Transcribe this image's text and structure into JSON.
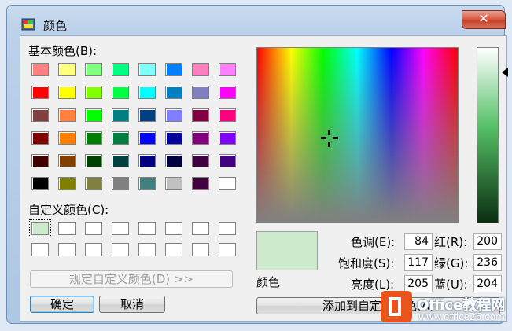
{
  "window": {
    "title": "颜色",
    "close_label": "✕"
  },
  "basic_colors": {
    "label": "基本颜色(B):",
    "swatches": [
      "#ff8080",
      "#ffff80",
      "#80ff80",
      "#00ff80",
      "#80ffff",
      "#0080ff",
      "#ff80c0",
      "#ff80ff",
      "#ff0000",
      "#ffff00",
      "#80ff00",
      "#00ff40",
      "#00ffff",
      "#0080c0",
      "#8080c0",
      "#ff00ff",
      "#804040",
      "#ff8040",
      "#00ff00",
      "#008080",
      "#004080",
      "#8080ff",
      "#800040",
      "#ff0080",
      "#800000",
      "#ff8000",
      "#008000",
      "#008040",
      "#0000ff",
      "#0000a0",
      "#800080",
      "#8000ff",
      "#400000",
      "#804000",
      "#004000",
      "#004040",
      "#000080",
      "#000040",
      "#400040",
      "#400080",
      "#000000",
      "#808000",
      "#808040",
      "#808080",
      "#408080",
      "#c0c0c0",
      "#400040",
      "#ffffff"
    ]
  },
  "custom_colors": {
    "label": "自定义颜色(C):",
    "swatches": [
      "#cdebcc",
      "#ffffff",
      "#ffffff",
      "#ffffff",
      "#ffffff",
      "#ffffff",
      "#ffffff",
      "#ffffff",
      "#ffffff",
      "#ffffff",
      "#ffffff",
      "#ffffff",
      "#ffffff",
      "#ffffff",
      "#ffffff",
      "#ffffff"
    ]
  },
  "buttons": {
    "define_custom": "规定自定义颜色(D) >>",
    "ok": "确定",
    "cancel": "取消",
    "add_custom": "添加到自定义颜色(A)"
  },
  "picker": {
    "preview_label": "颜色",
    "preview_color": "#cdebcc",
    "hue_label": "色调(E):",
    "hue": "84",
    "sat_label": "饱和度(S):",
    "sat": "117",
    "lum_label": "亮度(L):",
    "lum": "205",
    "red_label": "红(R):",
    "red": "200",
    "green_label": "绿(G):",
    "green": "236",
    "blue_label": "蓝(U):",
    "blue": "204"
  },
  "watermark": {
    "brand": "Office教程网",
    "url": "www.office26.com"
  }
}
